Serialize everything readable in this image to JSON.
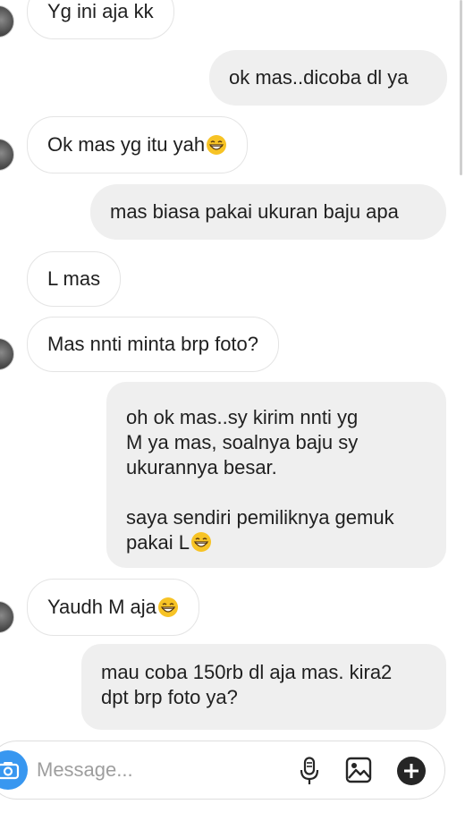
{
  "messages": [
    {
      "side": "in",
      "text": "Yg ini aja kk"
    },
    {
      "side": "out",
      "text": "ok mas..dicoba dl ya"
    },
    {
      "side": "in",
      "text": "Ok mas yg itu yah",
      "emoji": "grinning-face"
    },
    {
      "side": "out",
      "text": "mas biasa pakai ukuran baju apa"
    },
    {
      "side": "in",
      "text": "L mas"
    },
    {
      "side": "in",
      "text": "Mas nnti minta brp foto?"
    },
    {
      "side": "out",
      "text": "oh ok mas..sy kirim nnti yg\nM ya mas, soalnya baju sy\nukurannya besar.\n\nsaya sendiri pemiliknya gemuk\npakai L",
      "emoji": "grinning-face"
    },
    {
      "side": "in",
      "text": "Yaudh M aja",
      "emoji": "grinning-face"
    },
    {
      "side": "out",
      "text": "mau coba 150rb dl aja mas. kira2\ndpt brp foto ya?"
    }
  ],
  "composer": {
    "placeholder": "Message...",
    "icons": [
      "camera-icon",
      "microphone-icon",
      "gallery-icon",
      "plus-icon"
    ],
    "accent": "#3897f0"
  },
  "colors": {
    "outgoing_bubble": "#efefef",
    "incoming_border": "#e4e4e4",
    "text": "#1f1f1f"
  }
}
